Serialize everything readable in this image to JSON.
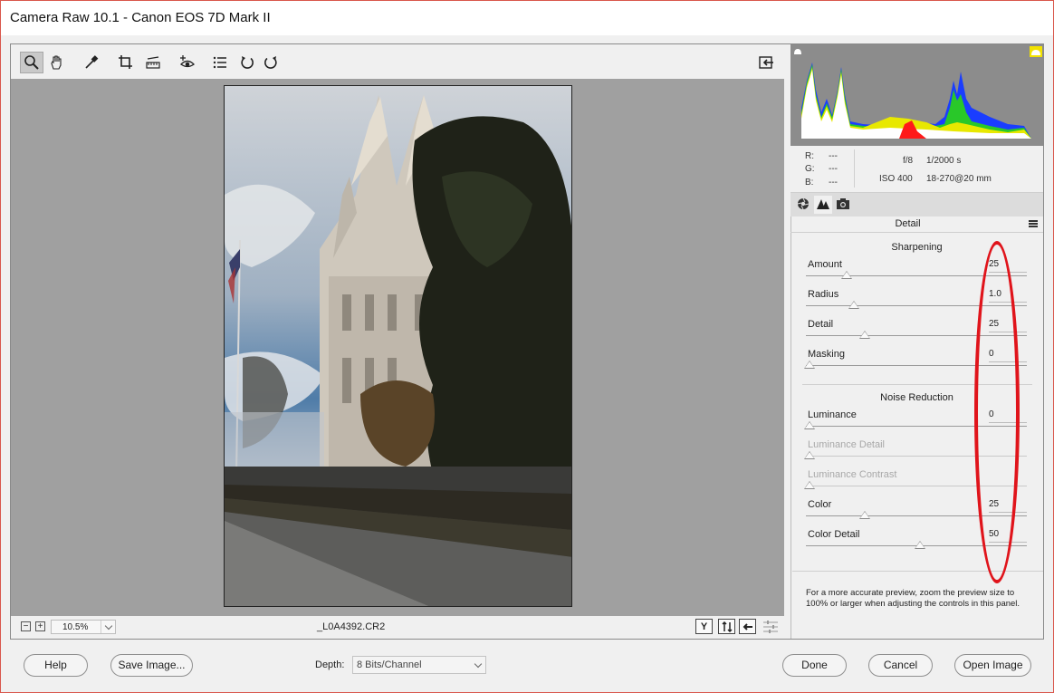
{
  "window": {
    "title": "Camera Raw 10.1  -  Canon EOS 7D Mark II"
  },
  "toolbar": {
    "tools": [
      "zoom-icon",
      "hand-icon",
      "white-balance-icon",
      "crop-icon",
      "straighten-icon",
      "red-eye-icon",
      "presets-icon",
      "rotate-left-icon",
      "rotate-right-icon"
    ],
    "open_toggle_icon": "toggle-fullscreen-icon"
  },
  "statusbar": {
    "zoom_minus": "−",
    "zoom_plus": "+",
    "zoom_level": "10.5%",
    "filename": "_L0A4392.CR2",
    "view_y": "Y"
  },
  "readout": {
    "r_label": "R:",
    "r_value": "---",
    "g_label": "G:",
    "g_value": "---",
    "b_label": "B:",
    "b_value": "---",
    "aperture": "f/8",
    "shutter": "1/2000 s",
    "iso": "ISO 400",
    "lens": "18-270@20 mm"
  },
  "panel": {
    "title": "Detail",
    "sharpening_title": "Sharpening",
    "noise_title": "Noise Reduction",
    "sharpening": [
      {
        "label": "Amount",
        "value": "25",
        "position": 0.17
      },
      {
        "label": "Radius",
        "value": "1.0",
        "position": 0.2
      },
      {
        "label": "Detail",
        "value": "25",
        "position": 0.25
      },
      {
        "label": "Masking",
        "value": "0",
        "position": 0.0
      }
    ],
    "noise": [
      {
        "label": "Luminance",
        "value": "0",
        "position": 0.0,
        "disabled": false
      },
      {
        "label": "Luminance Detail",
        "value": "",
        "position": 0.0,
        "disabled": true
      },
      {
        "label": "Luminance Contrast",
        "value": "",
        "position": 0.0,
        "disabled": true
      },
      {
        "label": "Color",
        "value": "25",
        "position": 0.25,
        "disabled": false
      },
      {
        "label": "Color Detail",
        "value": "50",
        "position": 0.5,
        "disabled": false
      }
    ],
    "note": "For a more accurate preview, zoom the preview size to 100% or larger when adjusting the controls in this panel."
  },
  "footer": {
    "help": "Help",
    "save": "Save Image...",
    "depth_label": "Depth:",
    "depth_value": "8 Bits/Channel",
    "done": "Done",
    "cancel": "Cancel",
    "open": "Open Image"
  },
  "colors": {
    "accent_red": "#e0141b",
    "preview_bg": "#a0a0a0",
    "histogram_bg": "#8c8c8c"
  }
}
